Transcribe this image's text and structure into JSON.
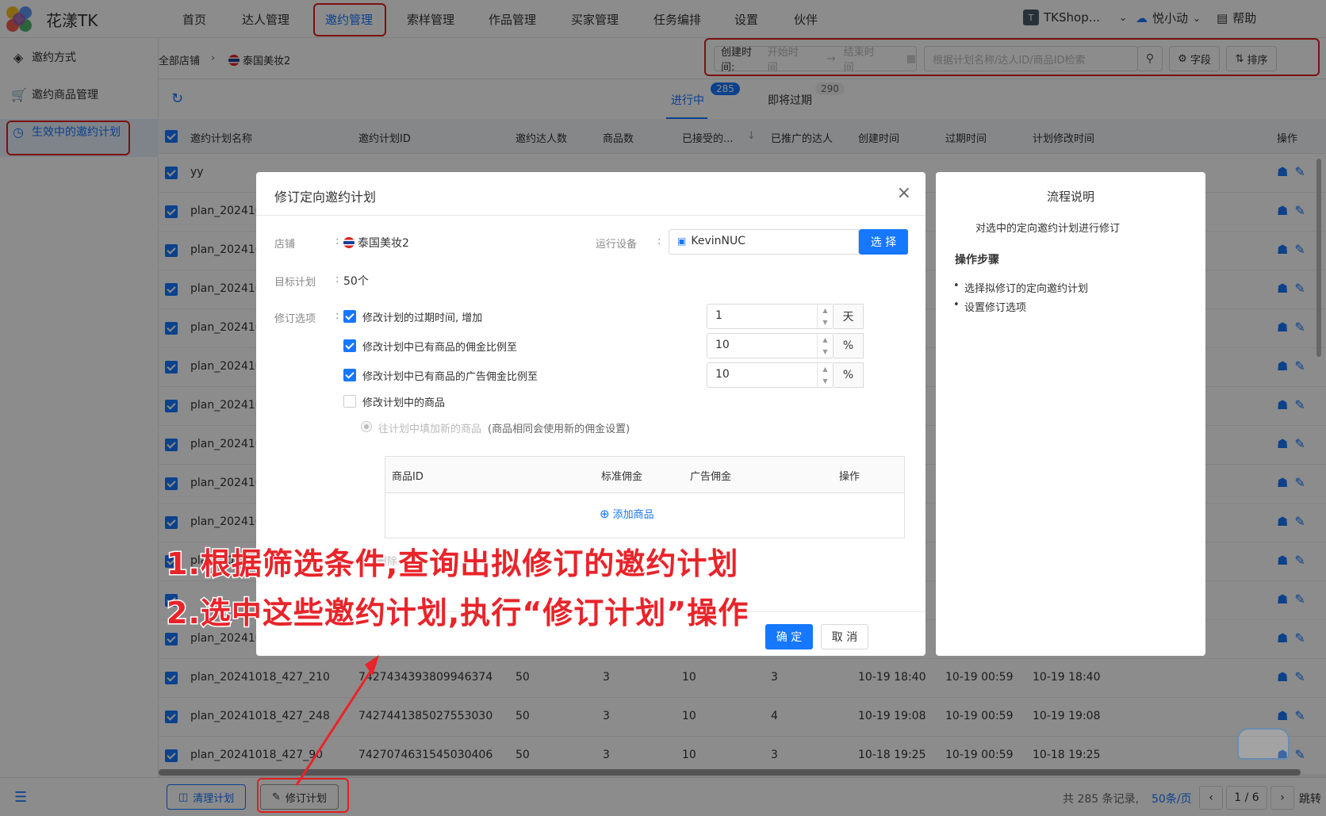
{
  "app": {
    "name": "花漾TK"
  },
  "nav": {
    "items": [
      "首页",
      "达人管理",
      "邀约管理",
      "索样管理",
      "作品管理",
      "买家管理",
      "任务编排",
      "设置",
      "伙伴"
    ],
    "shop_badge": "T",
    "shop": "TKShop...",
    "user": "悦小动",
    "help": "帮助"
  },
  "sidebar": {
    "items": [
      "邀约方式",
      "邀约商品管理",
      "生效中的邀约计划"
    ]
  },
  "breadcrumb": {
    "root": "全部店铺",
    "shop": "泰国美妆2"
  },
  "filter": {
    "created_label": "创建时间:",
    "start_placeholder": "开始时间",
    "end_placeholder": "结束时间",
    "search_placeholder": "根据计划名称/达人ID/商品ID检索",
    "fields_label": "字段",
    "sort_label": "排序"
  },
  "tabs": [
    {
      "label": "进行中",
      "count": "285"
    },
    {
      "label": "即将过期",
      "count": "290"
    }
  ],
  "table": {
    "columns": [
      "邀约计划名称",
      "邀约计划ID",
      "邀约达人数",
      "商品数",
      "已接受的...",
      "已推广的达人",
      "创建时间",
      "过期时间",
      "计划修改时间",
      "操作"
    ],
    "rows": [
      {
        "name": "yy"
      },
      {
        "name": "plan_202410"
      },
      {
        "name": "plan_202410"
      },
      {
        "name": "plan_202410"
      },
      {
        "name": "plan_202410"
      },
      {
        "name": "plan_202410"
      },
      {
        "name": "plan_202410"
      },
      {
        "name": "plan_202410"
      },
      {
        "name": "plan_202410"
      },
      {
        "name": "plan_202410"
      },
      {
        "name": "plan_202410"
      },
      {
        "name": ""
      },
      {
        "name": "plan_202410"
      },
      {
        "name": "plan_20241018_427_210",
        "id": "7427434393809946374",
        "invited": "50",
        "products": "3",
        "accepted": "10",
        "promoted": "3",
        "created": "10-19 18:40",
        "expires": "10-19 00:59",
        "modified": "10-19 18:40"
      },
      {
        "name": "plan_20241018_427_248",
        "id": "7427441385027553030",
        "invited": "50",
        "products": "3",
        "accepted": "10",
        "promoted": "4",
        "created": "10-19 19:08",
        "expires": "10-19 00:59",
        "modified": "10-19 19:08"
      },
      {
        "name": "plan_20241018_427_90",
        "id": "7427074631545030406",
        "invited": "50",
        "products": "3",
        "accepted": "10",
        "promoted": "3",
        "created": "10-18 19:25",
        "expires": "10-19 00:59",
        "modified": "10-18 19:25"
      }
    ]
  },
  "footer": {
    "clear_label": "清理计划",
    "revise_label": "修订计划",
    "total": "共 285 条记录,",
    "per_page": "50条/页",
    "page": "1 / 6",
    "jump": "跳转"
  },
  "modal": {
    "title": "修订定向邀约计划",
    "shop_label": "店铺",
    "shop_value": "泰国美妆2",
    "device_label": "运行设备",
    "device_value": "KevinNUC",
    "select_label": "选 择",
    "target_label": "目标计划",
    "target_value": "50个",
    "options_label": "修订选项",
    "options": [
      {
        "label": "修改计划的过期时间, 增加",
        "checked": true,
        "value": "1",
        "unit": "天"
      },
      {
        "label": "修改计划中已有商品的佣金比例至",
        "checked": true,
        "value": "10",
        "unit": "%"
      },
      {
        "label": "修改计划中已有商品的广告佣金比例至",
        "checked": true,
        "value": "10",
        "unit": "%"
      },
      {
        "label": "修改计划中的商品",
        "checked": false
      }
    ],
    "radio_label": "往计划中填加新的商品",
    "radio_note": "(商品相同会使用新的佣金设置)",
    "product_columns": [
      "商品ID",
      "标准佣金",
      "广告佣金",
      "操作"
    ],
    "add_product": "添加商品",
    "partial_text": "删除",
    "confirm": "确 定",
    "cancel": "取 消"
  },
  "help": {
    "title": "流程说明",
    "desc": "对选中的定向邀约计划进行修订",
    "steps_title": "操作步骤",
    "steps": [
      "选择拟修订的定向邀约计划",
      "设置修订选项"
    ]
  },
  "annotations": [
    "1.根据筛选条件,查询出拟修订的邀约计划",
    "2.选中这些邀约计划,执行“修订计划”操作"
  ],
  "colors": {
    "accent": "#1677ff",
    "highlight": "#e02020",
    "annotation": "#e8242a"
  }
}
